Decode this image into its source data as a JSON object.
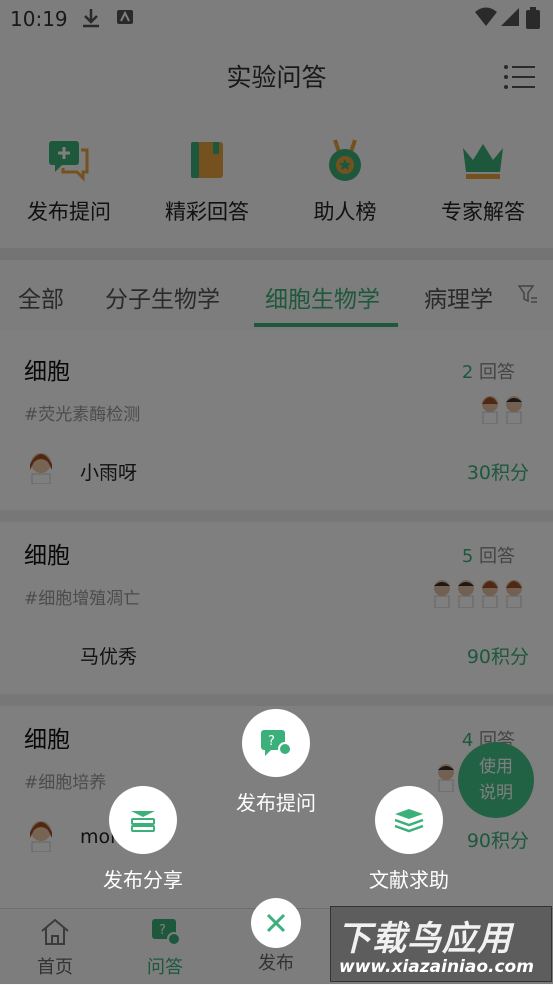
{
  "status_bar": {
    "time": "10:19"
  },
  "header": {
    "title": "实验问答"
  },
  "quick_actions": [
    {
      "label": "发布提问",
      "icon": "chat-question-icon"
    },
    {
      "label": "精彩回答",
      "icon": "book-icon"
    },
    {
      "label": "助人榜",
      "icon": "medal-icon"
    },
    {
      "label": "专家解答",
      "icon": "crown-icon"
    }
  ],
  "tabs": [
    {
      "label": "全部"
    },
    {
      "label": "分子生物学"
    },
    {
      "label": "细胞生物学",
      "active": true
    },
    {
      "label": "病理学"
    }
  ],
  "questions": [
    {
      "title": "细胞",
      "answer_num": "2",
      "answer_suffix": " 回答",
      "tag": "#荧光素酶检测",
      "user": "小雨呀",
      "points": "30积分"
    },
    {
      "title": "细胞",
      "answer_num": "5",
      "answer_suffix": " 回答",
      "tag": "#细胞增殖凋亡",
      "user": "马优秀",
      "points": "90积分"
    },
    {
      "title": "细胞",
      "answer_num": "4",
      "answer_suffix": " 回答",
      "tag": "#细胞培养",
      "user": "mor",
      "points": "90积分"
    }
  ],
  "help_button": {
    "line1": "使用",
    "line2": "说明"
  },
  "bottom_nav": [
    {
      "label": "首页",
      "icon": "home-icon"
    },
    {
      "label": "问答",
      "icon": "qa-icon",
      "active": true
    },
    {
      "label": "发布",
      "icon": "publish-icon"
    }
  ],
  "publish_menu": {
    "ask": "发布提问",
    "share": "发布分享",
    "literature": "文献求助"
  },
  "watermark": {
    "line1": "下载鸟应用",
    "line2": "www.xiazainiao.com"
  },
  "colors": {
    "accent": "#3bb07b",
    "overlay": "rgba(0,0,0,0.5)",
    "gold": "#e8a33d"
  }
}
